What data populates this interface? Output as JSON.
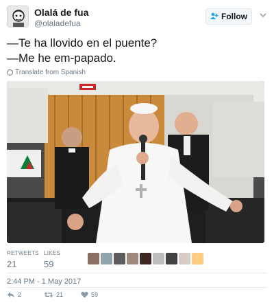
{
  "author": {
    "name": "Olalá de fua",
    "handle": "@olaladefua",
    "follow_label": "Follow"
  },
  "tweet": {
    "line1": "—Te ha llovido en el puente?",
    "line2": "—Me he em-papado.",
    "translate_label": "Translate from Spanish"
  },
  "stats": {
    "retweets_label": "RETWEETS",
    "retweets_value": "21",
    "likes_label": "LIKES",
    "likes_value": "59"
  },
  "timestamp": "2:44 PM - 1 May 2017",
  "actions": {
    "reply_count": "2",
    "retweet_count": "21",
    "like_count": "59"
  },
  "icons": [
    "add-user-icon",
    "chevron-down-icon",
    "globe-icon",
    "reply-icon",
    "retweet-icon",
    "heart-icon"
  ],
  "colors": {
    "accent": "#1da1f2",
    "muted": "#657786",
    "border": "#e1e8ed"
  }
}
